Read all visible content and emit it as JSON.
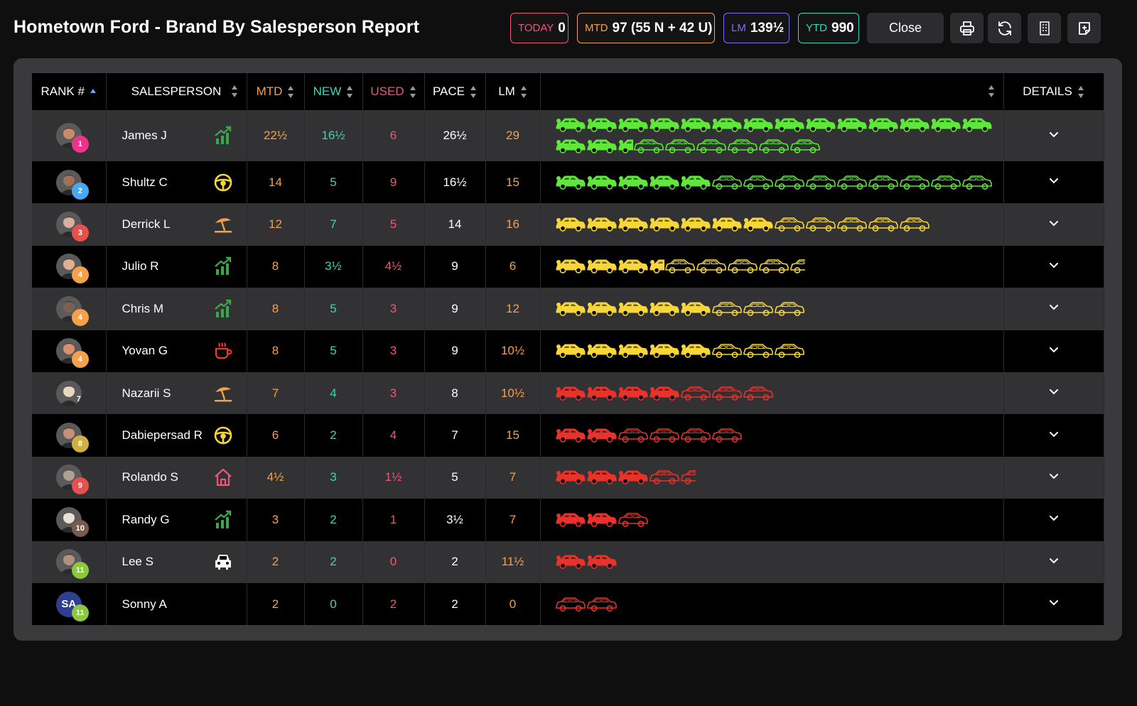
{
  "header": {
    "title": "Hometown Ford - Brand By Salesperson Report",
    "today": {
      "label": "TODAY",
      "value": "0"
    },
    "mtd": {
      "label": "MTD",
      "value": "97 (55 N + 42 U)"
    },
    "lm": {
      "label": "LM",
      "value": "139½"
    },
    "ytd": {
      "label": "YTD",
      "value": "990"
    },
    "close_label": "Close"
  },
  "colors": {
    "green": "#5ee83a",
    "yellow": "#f7d63a",
    "red": "#e8322a",
    "today": "#f0567a",
    "mtd": "#f5a04b",
    "lm": "#7b6cff",
    "ytd": "#3cd6b8"
  },
  "columns": [
    "RANK #",
    "SALESPERSON",
    "MTD",
    "NEW",
    "USED",
    "PACE",
    "LM",
    "",
    "DETAILS"
  ],
  "rows": [
    {
      "rank": "1",
      "rank_color": "#f0338a",
      "name": "James J",
      "status_icon": "trending-up-icon",
      "mtd": "22½",
      "new": "16½",
      "used": "6",
      "pace": "26½",
      "lm": "29",
      "tier": "green",
      "new_full": 16,
      "new_half": 1,
      "used_full": 6,
      "used_half": 0,
      "face": "#c98a6a"
    },
    {
      "rank": "2",
      "rank_color": "#4aa8f0",
      "name": "Shultz C",
      "status_icon": "steering-wheel-icon",
      "mtd": "14",
      "new": "5",
      "used": "9",
      "pace": "16½",
      "lm": "15",
      "tier": "green",
      "new_full": 5,
      "new_half": 0,
      "used_full": 9,
      "used_half": 0,
      "face": "#a07058"
    },
    {
      "rank": "3",
      "rank_color": "#e85050",
      "name": "Derrick L",
      "status_icon": "beach-umbrella-icon",
      "mtd": "12",
      "new": "7",
      "used": "5",
      "pace": "14",
      "lm": "16",
      "tier": "yellow",
      "new_full": 7,
      "new_half": 0,
      "used_full": 5,
      "used_half": 0,
      "face": "#d8b0a0"
    },
    {
      "rank": "4",
      "rank_color": "#f5a04b",
      "name": "Julio R",
      "status_icon": "trending-up-icon",
      "mtd": "8",
      "new": "3½",
      "used": "4½",
      "pace": "9",
      "lm": "6",
      "tier": "yellow",
      "new_full": 3,
      "new_half": 1,
      "used_full": 4,
      "used_half": 1,
      "face": "#e0b090"
    },
    {
      "rank": "4",
      "rank_color": "#f5a04b",
      "name": "Chris M",
      "status_icon": "trending-up-icon",
      "mtd": "8",
      "new": "5",
      "used": "3",
      "pace": "9",
      "lm": "12",
      "tier": "yellow",
      "new_full": 5,
      "new_half": 0,
      "used_full": 3,
      "used_half": 0,
      "face": "#7a6050"
    },
    {
      "rank": "4",
      "rank_color": "#f5a04b",
      "name": "Yovan G",
      "status_icon": "coffee-cup-icon",
      "mtd": "8",
      "new": "5",
      "used": "3",
      "pace": "9",
      "lm": "10½",
      "tier": "yellow",
      "new_full": 5,
      "new_half": 0,
      "used_full": 3,
      "used_half": 0,
      "face": "#d89070"
    },
    {
      "rank": "7",
      "rank_color": "transparent",
      "name": "Nazarii S",
      "status_icon": "beach-umbrella-icon",
      "mtd": "7",
      "new": "4",
      "used": "3",
      "pace": "8",
      "lm": "10½",
      "tier": "red",
      "new_full": 4,
      "new_half": 0,
      "used_full": 3,
      "used_half": 0,
      "face": "#e8d8c0"
    },
    {
      "rank": "8",
      "rank_color": "#d0b040",
      "name": "Dabiepersad R",
      "status_icon": "steering-wheel-icon",
      "mtd": "6",
      "new": "2",
      "used": "4",
      "pace": "7",
      "lm": "15",
      "tier": "red",
      "new_full": 2,
      "new_half": 0,
      "used_full": 4,
      "used_half": 0,
      "face": "#c89078"
    },
    {
      "rank": "9",
      "rank_color": "#e85050",
      "name": "Rolando S",
      "status_icon": "home-icon",
      "mtd": "4½",
      "new": "3",
      "used": "1½",
      "pace": "5",
      "lm": "7",
      "tier": "red",
      "new_full": 3,
      "new_half": 0,
      "used_full": 1,
      "used_half": 1,
      "face": "#b0a090"
    },
    {
      "rank": "10",
      "rank_color": "#7a5a4a",
      "name": "Randy G",
      "status_icon": "trending-up-icon",
      "mtd": "3",
      "new": "2",
      "used": "1",
      "pace": "3½",
      "lm": "7",
      "tier": "red",
      "new_full": 2,
      "new_half": 0,
      "used_full": 1,
      "used_half": 0,
      "face": "#e8e0d8"
    },
    {
      "rank": "11",
      "rank_color": "#8ac840",
      "name": "Lee S",
      "status_icon": "car-front-icon",
      "mtd": "2",
      "new": "2",
      "used": "0",
      "pace": "2",
      "lm": "11½",
      "tier": "red",
      "new_full": 2,
      "new_half": 0,
      "used_full": 0,
      "used_half": 0,
      "face": "#b09080"
    },
    {
      "rank": "11",
      "rank_color": "#8ac840",
      "name": "Sonny A",
      "initials": "SA",
      "status_icon": "",
      "mtd": "2",
      "new": "0",
      "used": "2",
      "pace": "2",
      "lm": "0",
      "tier": "red",
      "new_full": 0,
      "new_half": 0,
      "used_full": 2,
      "used_half": 0,
      "face": ""
    }
  ]
}
